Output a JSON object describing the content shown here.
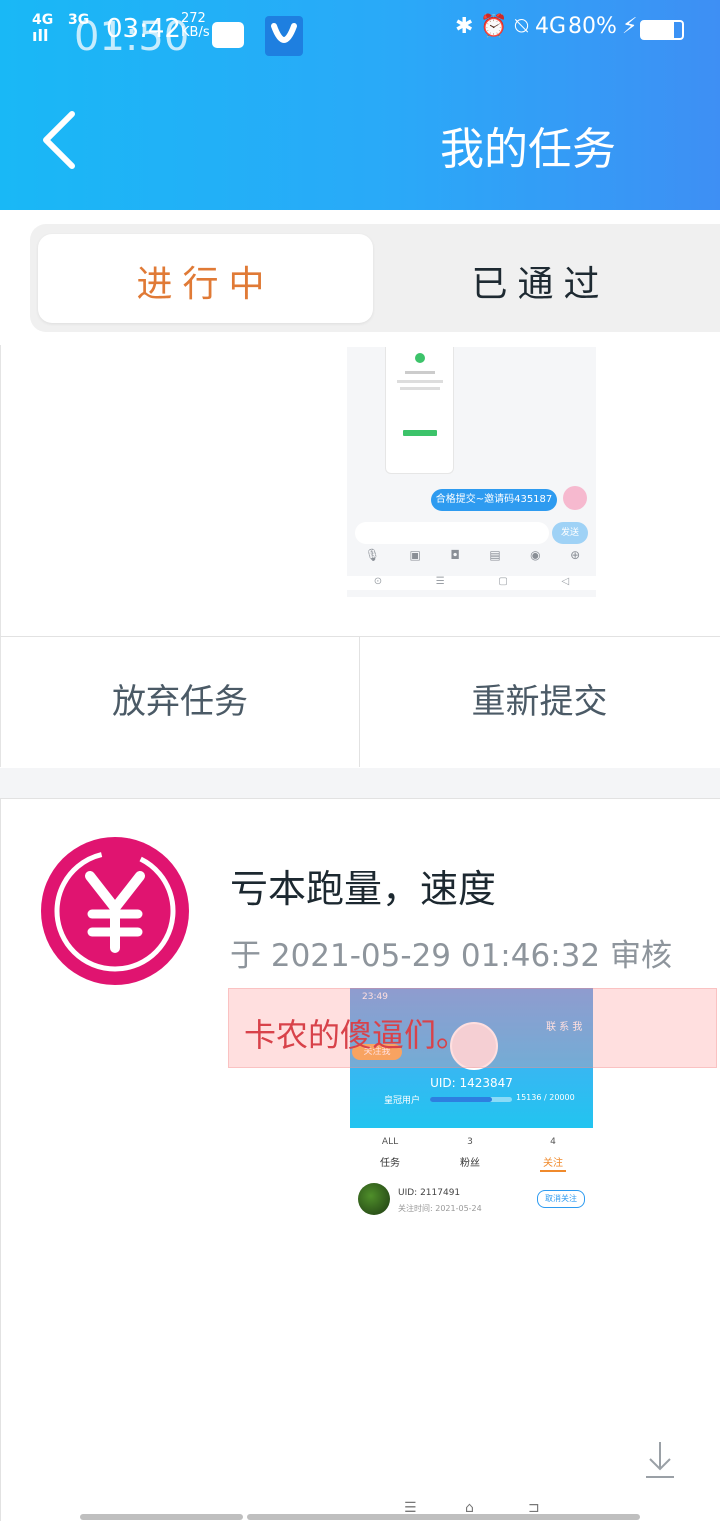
{
  "status_bar": {
    "network1": "4G",
    "network2": "3G",
    "signal": "ıl",
    "time_ghost": "01:50",
    "time": "03:42",
    "speed_value": "272",
    "speed_unit": "KB/s",
    "right_icons": "✱ ⏰ ⍉ 4G",
    "battery": "80%",
    "charging": "⚡"
  },
  "header": {
    "title": "我的任务",
    "back_icon": "chevron-left-icon"
  },
  "tabs": [
    {
      "label": "进行中",
      "active": true
    },
    {
      "label": "已通过",
      "active": false
    }
  ],
  "card1": {
    "chat_message": "合格提交~邀请码435187",
    "send_label": "发送",
    "abandon_label": "放弃任务",
    "resubmit_label": "重新提交"
  },
  "card2": {
    "title": "亏本跑量，速度",
    "meta": "于 2021-05-29 01:46:32 审核",
    "overlay_text": "卡农的傻逼们。",
    "screenshot": {
      "time": "23:49",
      "contact": "联 系 我",
      "follow_pill": "关注我",
      "uid": "UID: 1423847",
      "vip": "皇冠用户",
      "progress": "15136 / 20000",
      "progress_fraction": 0.757,
      "stats": [
        {
          "count": "ALL",
          "label": "任务"
        },
        {
          "count": "3",
          "label": "粉丝"
        },
        {
          "count": "4",
          "label": "关注"
        }
      ],
      "follow_uid": "UID: 2117491",
      "follow_date": "关注时间: 2021-05-24",
      "unfollow": "取消关注"
    }
  },
  "nav": {
    "menu": "☰",
    "home": "⌂",
    "back": "⊐"
  },
  "colors": {
    "header_start": "#19b8f6",
    "header_end": "#3e8ff4",
    "active_tab_text": "#e07a36",
    "coin": "#e01470"
  }
}
